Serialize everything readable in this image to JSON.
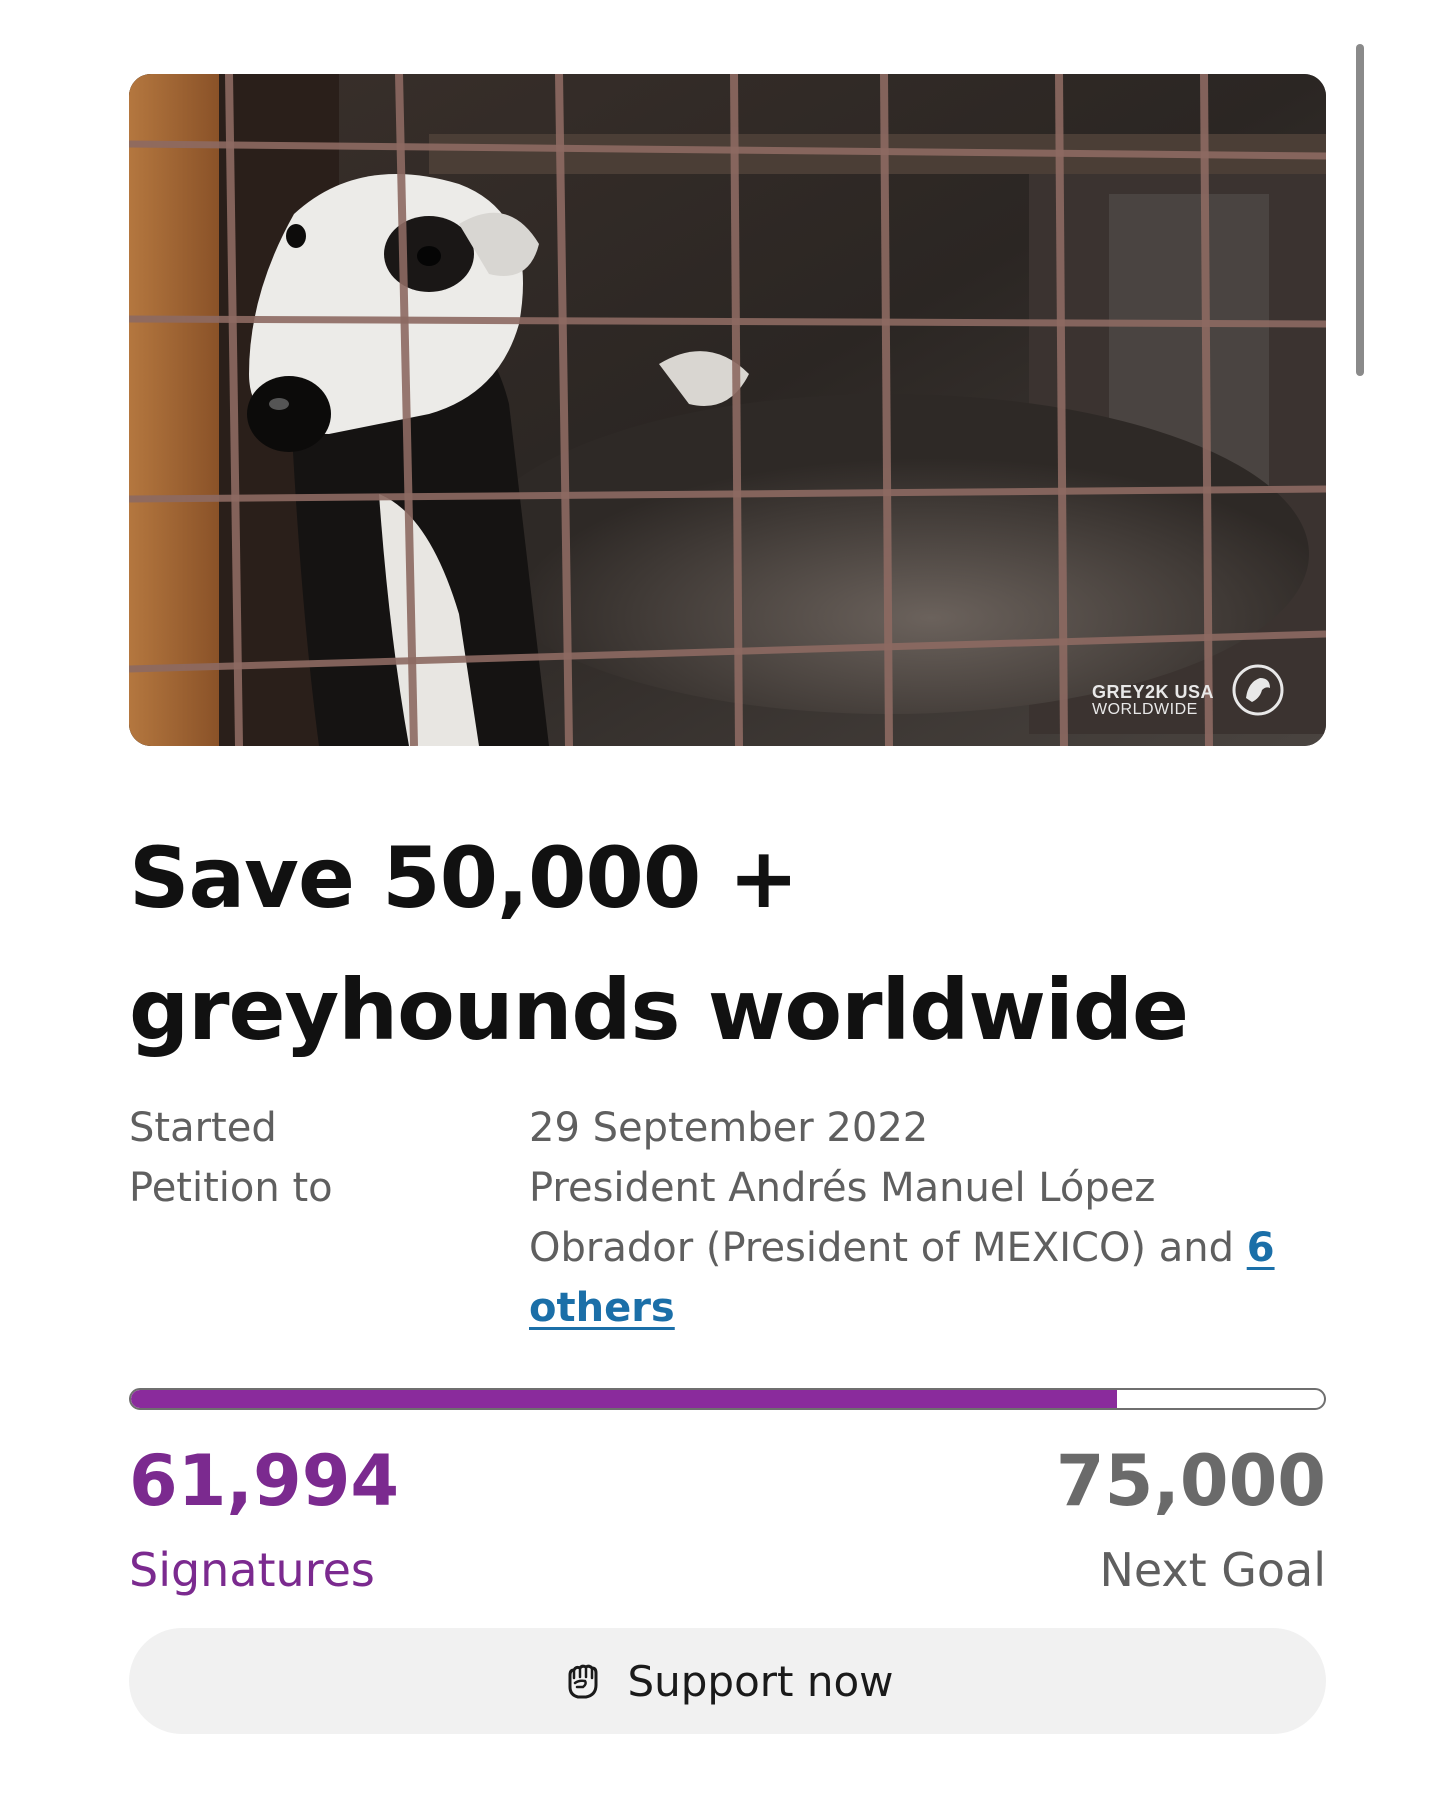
{
  "hero": {
    "watermark_line1": "GREY2K USA",
    "watermark_line2": "WORLDWIDE"
  },
  "petition": {
    "title": "Save 50,000 + greyhounds worldwide",
    "started_label": "Started",
    "started_value": "29 September 2022",
    "petition_to_label": "Petition to",
    "petition_to_value": "President Andrés Manuel López Obrador (President of MEXICO) and ",
    "others_link": "6 others"
  },
  "progress": {
    "signatures": "61,994",
    "signatures_label": "Signatures",
    "goal": "75,000",
    "goal_label": "Next Goal",
    "fraction": 0.8266,
    "fill_color": "#8a2b9c"
  },
  "actions": {
    "support_label": "Support now",
    "support_icon": "fist-icon"
  },
  "colors": {
    "accent": "#7b2a8f",
    "link": "#1b6fa8"
  }
}
